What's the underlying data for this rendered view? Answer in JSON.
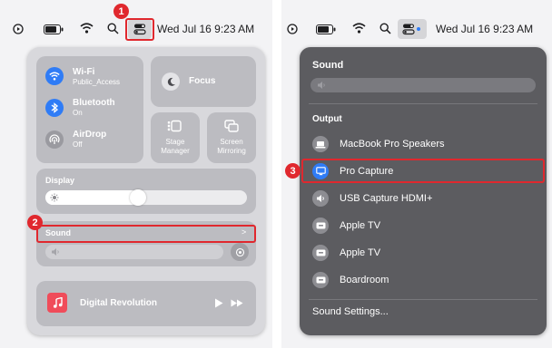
{
  "left": {
    "menubar": {
      "clock": "Wed Jul 16  9:23 AM"
    },
    "control_center": {
      "wifi": {
        "title": "Wi-Fi",
        "subtitle": "Public_Access"
      },
      "bluetooth": {
        "title": "Bluetooth",
        "subtitle": "On"
      },
      "airdrop": {
        "title": "AirDrop",
        "subtitle": "Off"
      },
      "focus": {
        "label": "Focus"
      },
      "stage_manager": {
        "label_line1": "Stage",
        "label_line2": "Manager"
      },
      "screen_mirroring": {
        "label_line1": "Screen",
        "label_line2": "Mirroring"
      },
      "display": {
        "label": "Display",
        "brightness": 0.45
      },
      "sound": {
        "label": "Sound",
        "chevron": ">",
        "volume": 0.0
      },
      "now_playing": {
        "title": "Digital Revolution"
      }
    },
    "callouts": {
      "one": "1",
      "two": "2"
    }
  },
  "right": {
    "menubar": {
      "clock": "Wed Jul 16  9:23 AM"
    },
    "sound_menu": {
      "title": "Sound",
      "output_heading": "Output",
      "devices": [
        {
          "label": "MacBook Pro Speakers",
          "icon": "laptop-icon",
          "selected": false
        },
        {
          "label": "Pro Capture",
          "icon": "display-icon",
          "selected": true
        },
        {
          "label": "USB Capture HDMI+",
          "icon": "speaker-icon",
          "selected": false
        },
        {
          "label": "Apple TV",
          "icon": "appletv-icon",
          "selected": false
        },
        {
          "label": "Apple TV",
          "icon": "appletv-icon",
          "selected": false
        },
        {
          "label": "Boardroom",
          "icon": "appletv-icon",
          "selected": false
        }
      ],
      "settings_label": "Sound Settings..."
    },
    "callouts": {
      "three": "3"
    }
  },
  "colors": {
    "accent": "#2f7cf6",
    "callout": "#e0282e"
  }
}
